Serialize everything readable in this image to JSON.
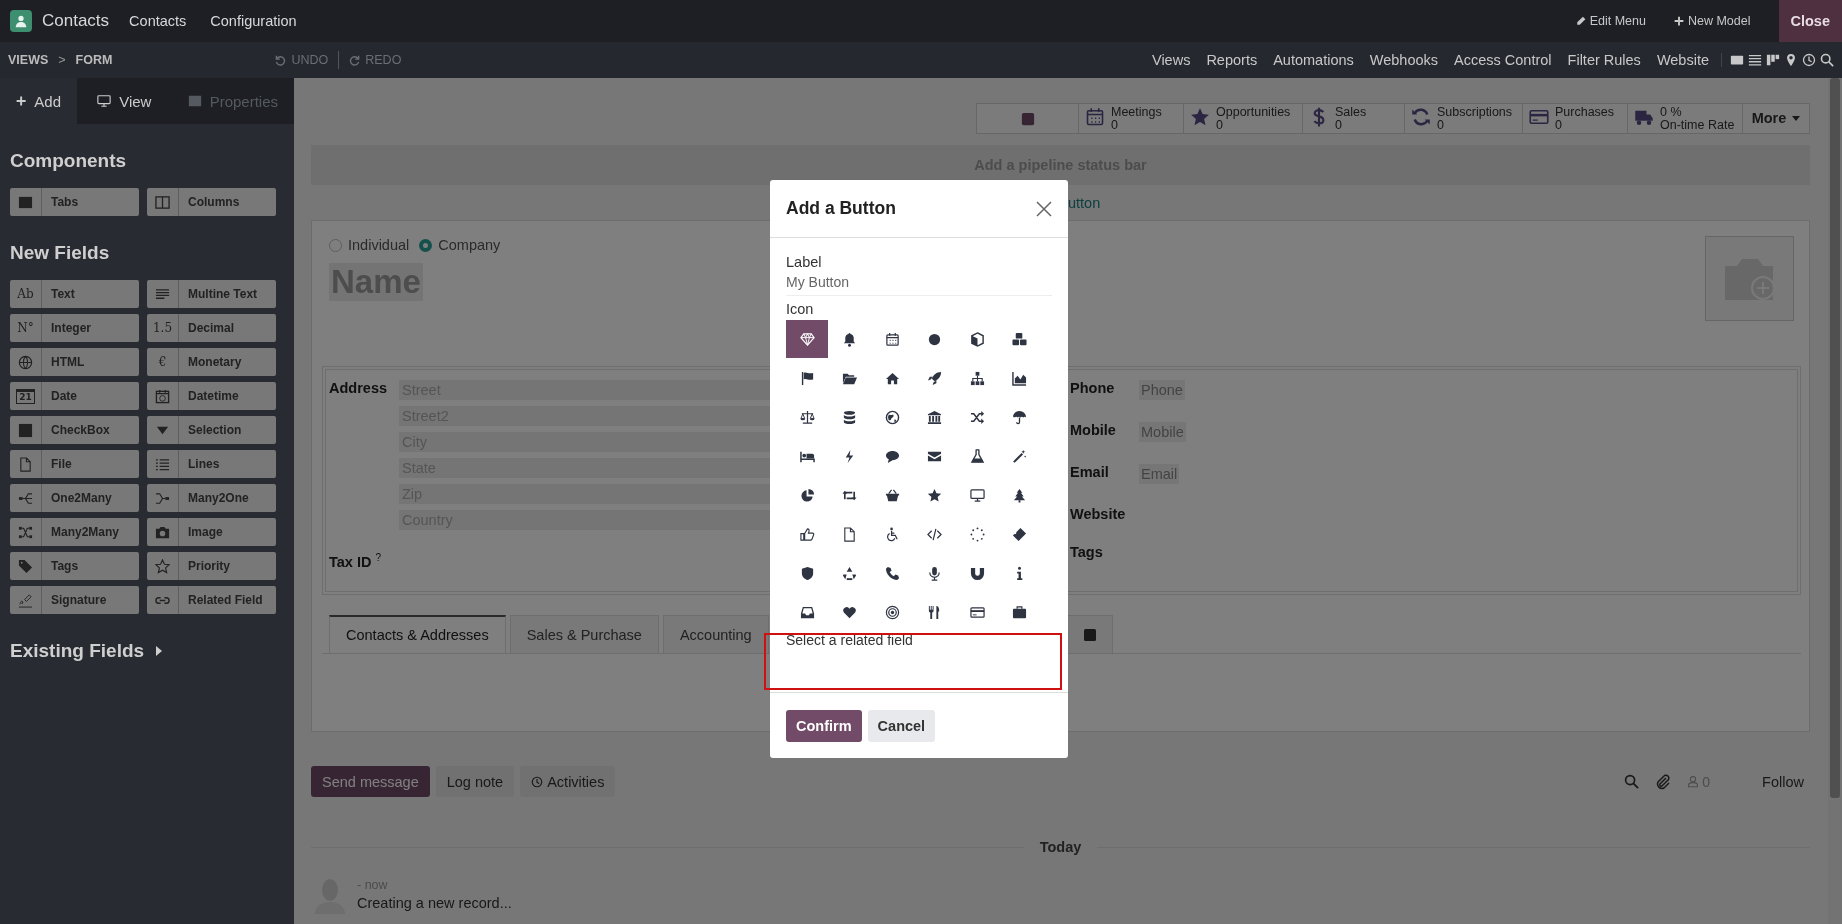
{
  "topbar": {
    "app_name": "Contacts",
    "menu": [
      "Contacts",
      "Configuration"
    ],
    "edit_menu": "Edit Menu",
    "new_model": "New Model",
    "close": "Close"
  },
  "studio_bar": {
    "breadcrumb": [
      "VIEWS",
      "FORM"
    ],
    "separator": ">",
    "undo": {
      "label": "UNDO",
      "disabled": true
    },
    "redo": {
      "label": "REDO",
      "disabled": true
    },
    "links": [
      "Views",
      "Reports",
      "Automations",
      "Webhooks",
      "Access Control",
      "Filter Rules",
      "Website"
    ]
  },
  "sidebar": {
    "tabs": [
      {
        "label": "Add",
        "selected": true,
        "disabled": false
      },
      {
        "label": "View",
        "selected": false,
        "disabled": false
      },
      {
        "label": "Properties",
        "selected": false,
        "disabled": true
      }
    ],
    "components_title": "Components",
    "components": [
      {
        "label": "Tabs"
      },
      {
        "label": "Columns"
      }
    ],
    "new_fields_title": "New Fields",
    "new_fields": [
      {
        "label": "Text",
        "glyph": "Ab"
      },
      {
        "label": "Multine Text"
      },
      {
        "label": "Integer",
        "glyph": "N°"
      },
      {
        "label": "Decimal",
        "glyph": "1.5"
      },
      {
        "label": "HTML"
      },
      {
        "label": "Monetary",
        "glyph": "€"
      },
      {
        "label": "Date",
        "glyph": "21"
      },
      {
        "label": "Datetime"
      },
      {
        "label": "CheckBox"
      },
      {
        "label": "Selection"
      },
      {
        "label": "File"
      },
      {
        "label": "Lines"
      },
      {
        "label": "One2Many"
      },
      {
        "label": "Many2One"
      },
      {
        "label": "Many2Many"
      },
      {
        "label": "Image"
      },
      {
        "label": "Tags"
      },
      {
        "label": "Priority"
      },
      {
        "label": "Signature"
      },
      {
        "label": "Related Field"
      }
    ],
    "existing_fields_title": "Existing Fields"
  },
  "form": {
    "smart_buttons": [
      {
        "kind": "add"
      },
      {
        "kind": "stat",
        "label": "Meetings",
        "value": "0"
      },
      {
        "kind": "stat",
        "label": "Opportunities",
        "value": "0"
      },
      {
        "kind": "stat",
        "label": "Sales",
        "value": "0"
      },
      {
        "kind": "stat",
        "label": "Subscriptions",
        "value": "0"
      },
      {
        "kind": "stat",
        "label": "Purchases",
        "value": "0"
      },
      {
        "kind": "rate",
        "value": "0 %",
        "label": "On-time Rate"
      },
      {
        "kind": "more",
        "label": "More"
      }
    ],
    "status_bar_hint": "Add a pipeline status bar",
    "add_button_hint": "utton",
    "company_type": [
      {
        "label": "Individual",
        "selected": false
      },
      {
        "label": "Company",
        "selected": true
      }
    ],
    "name_placeholder": "Name",
    "address": {
      "label": "Address",
      "fields": [
        "Street",
        "Street2",
        "City",
        "State",
        "Zip",
        "Country"
      ]
    },
    "tax_id": "Tax ID $^{?}$",
    "contact_fields": [
      {
        "label": "Phone",
        "placeholder": "Phone"
      },
      {
        "label": "Mobile",
        "placeholder": "Mobile"
      },
      {
        "label": "Email",
        "placeholder": "Email"
      },
      {
        "label": "Website"
      },
      {
        "label": "Tags"
      }
    ],
    "tabs": [
      {
        "label": "Contacts & Addresses",
        "selected": true
      },
      {
        "label": "Sales & Purchase",
        "selected": false
      },
      {
        "label": "Accounting",
        "selected": false
      }
    ]
  },
  "chatter": {
    "send_message": "Send message",
    "log_note": "Log note",
    "activities": "Activities",
    "followers": "0",
    "follow": "Follow",
    "date_separator": "Today",
    "messages": [
      {
        "time": "- now",
        "body": "Creating a new record..."
      }
    ]
  },
  "dialog": {
    "title": "Add a Button",
    "label_caption": "Label",
    "label_value": "My Button",
    "icon_caption": "Icon",
    "icons": [
      {
        "selected": true
      },
      {
        "selected": false
      },
      {
        "selected": false
      },
      {
        "selected": false
      },
      {
        "selected": false
      },
      {
        "selected": false
      },
      {
        "selected": false
      },
      {
        "selected": false
      },
      {
        "selected": false
      },
      {
        "selected": false
      },
      {
        "selected": false
      },
      {
        "selected": false
      },
      {
        "selected": false
      },
      {
        "selected": false
      },
      {
        "selected": false
      },
      {
        "selected": false
      },
      {
        "selected": false
      },
      {
        "selected": false
      },
      {
        "selected": false
      },
      {
        "selected": false
      },
      {
        "selected": false
      },
      {
        "selected": false
      },
      {
        "selected": false
      },
      {
        "selected": false
      },
      {
        "selected": false
      },
      {
        "selected": false
      },
      {
        "selected": false
      },
      {
        "selected": false
      },
      {
        "selected": false
      },
      {
        "selected": false
      },
      {
        "selected": false
      },
      {
        "selected": false
      },
      {
        "selected": false
      },
      {
        "selected": false
      },
      {
        "selected": false
      },
      {
        "selected": false
      },
      {
        "selected": false
      },
      {
        "selected": false
      },
      {
        "selected": false
      },
      {
        "selected": false
      },
      {
        "selected": false
      },
      {
        "selected": false
      },
      {
        "selected": false
      },
      {
        "selected": false
      },
      {
        "selected": false
      },
      {
        "selected": false
      },
      {
        "selected": false
      },
      {
        "selected": false
      }
    ],
    "related_field_placeholder": "Select a related field",
    "related_field_highlighted": true,
    "confirm": "Confirm",
    "cancel": "Cancel"
  }
}
